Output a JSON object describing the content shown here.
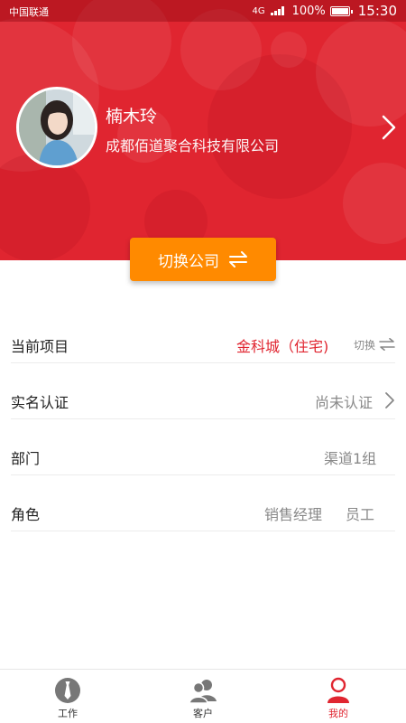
{
  "status_bar": {
    "carrier": "中国联通",
    "network": "4G",
    "battery": "100%",
    "time": "15:30"
  },
  "profile": {
    "name": "楠木玲",
    "company": "成都佰道聚合科技有限公司"
  },
  "switch_company_button": {
    "label": "切换公司"
  },
  "info_rows": {
    "project": {
      "label": "当前项目",
      "value": "金科城（住宅)",
      "action": "切换"
    },
    "verification": {
      "label": "实名认证",
      "value": "尚未认证"
    },
    "department": {
      "label": "部门",
      "value": "渠道1组"
    },
    "role": {
      "label": "角色",
      "value_primary": "销售经理",
      "value_secondary": "员工"
    }
  },
  "tabbar": {
    "tabs": [
      {
        "label": "工作",
        "icon": "tie-icon"
      },
      {
        "label": "客户",
        "icon": "customers-icon"
      },
      {
        "label": "我的",
        "icon": "user-icon",
        "active": true
      }
    ]
  },
  "colors": {
    "brand_red": "#e02530",
    "button_orange": "#ff8a00"
  }
}
